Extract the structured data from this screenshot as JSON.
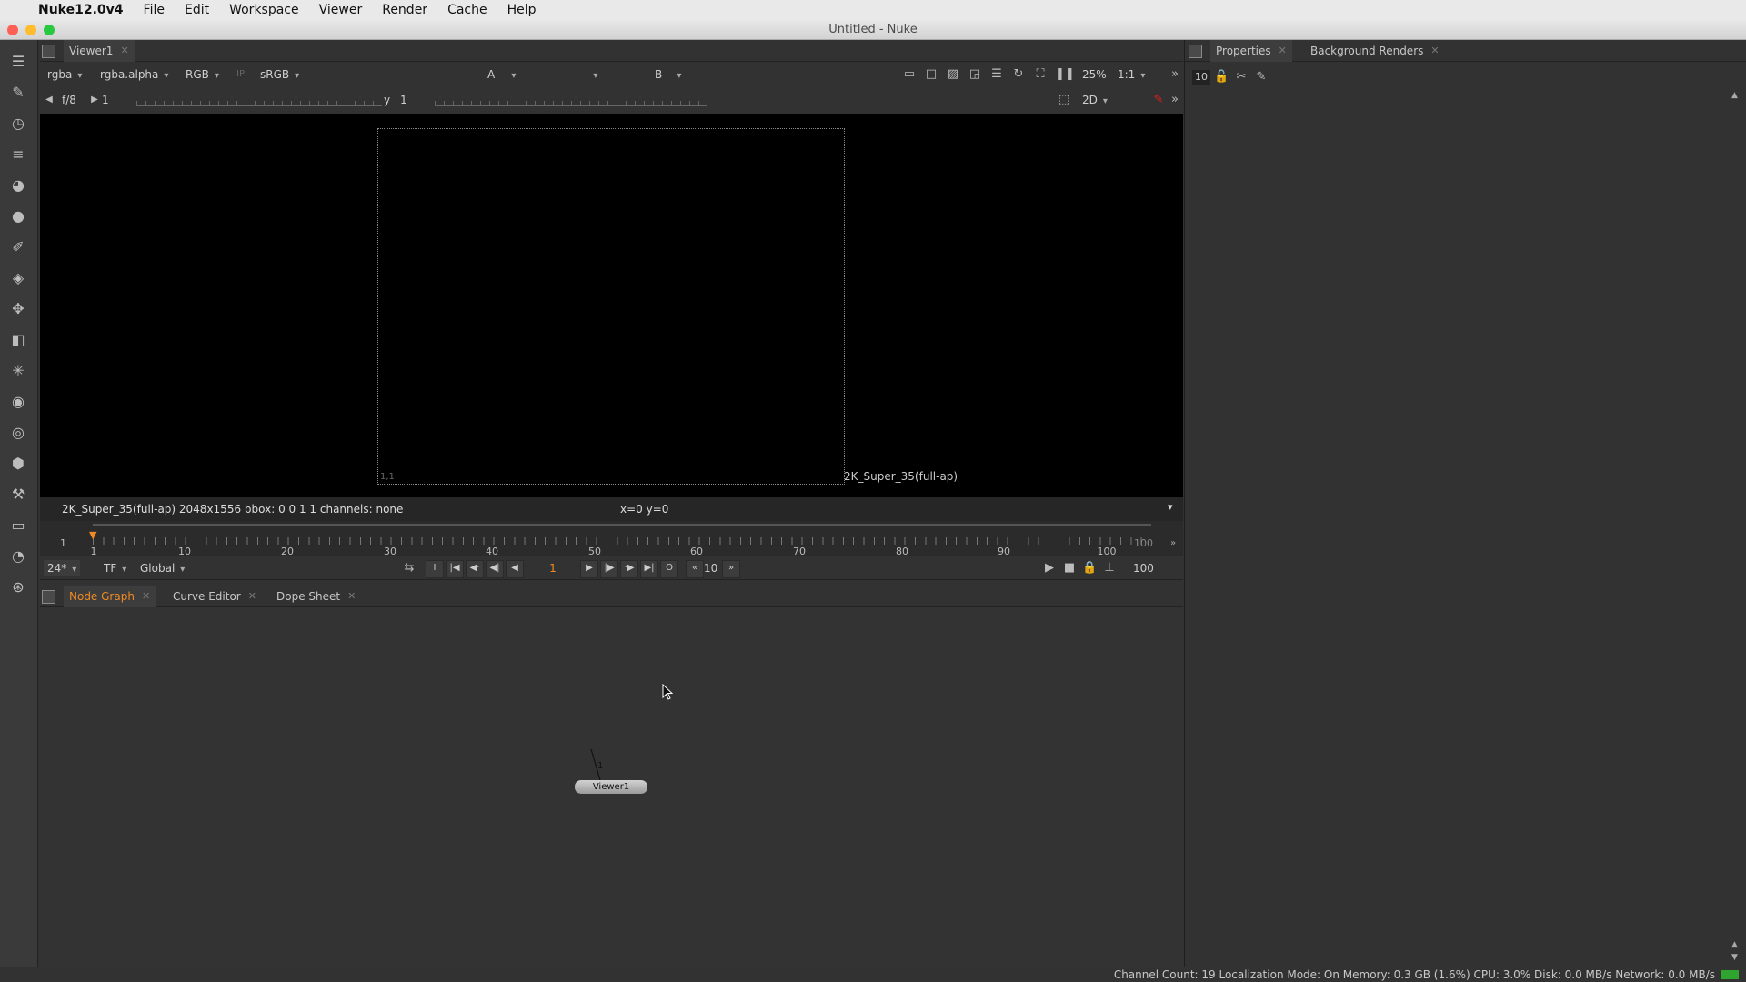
{
  "menubar": {
    "app_name": "Nuke12.0v4",
    "items": [
      "File",
      "Edit",
      "Workspace",
      "Viewer",
      "Render",
      "Cache",
      "Help"
    ]
  },
  "window": {
    "title": "Untitled - Nuke"
  },
  "toolbar": {
    "icons": [
      "viewer-tools-icon",
      "paint-icon",
      "time-icon",
      "channel-icon",
      "color-icon",
      "filter-icon",
      "draw-icon",
      "merge-icon",
      "transform-icon",
      "3d-icon",
      "particles-icon",
      "deep-icon",
      "views-icon",
      "metadata-icon",
      "toolsets-icon",
      "other-icon",
      "furnace-icon",
      "ocula-icon"
    ]
  },
  "viewer": {
    "tab_label": "Viewer1",
    "channels": "rgba",
    "alpha": "rgba.alpha",
    "display": "RGB",
    "ip": "IP",
    "lut": "sRGB",
    "input_a": "A",
    "input_a_value": "-",
    "wipe": "-",
    "input_b": "B",
    "input_b_value": "-",
    "zoom": "25%",
    "ratio": "1:1",
    "fstop": "f/8",
    "gain": "1",
    "gamma_label": "y",
    "gamma": "1",
    "view_mode": "2D",
    "format_label": "2K_Super_35(full-ap)",
    "corner_label": "1,1",
    "info": "2K_Super_35(full-ap) 2048x1556  bbox: 0 0 1 1 channels: none",
    "coords": "x=0 y=0"
  },
  "timeline": {
    "start": "1",
    "end": "100",
    "current": "1",
    "ticks": [
      "1",
      "10",
      "20",
      "30",
      "40",
      "50",
      "60",
      "70",
      "80",
      "90",
      "100"
    ],
    "fps": "24*",
    "tf": "TF",
    "range": "Global",
    "frame": "1",
    "increment": "10",
    "out_frame": "100"
  },
  "bottom_tabs": [
    "Node Graph",
    "Curve Editor",
    "Dope Sheet"
  ],
  "node_graph": {
    "node_label": "Viewer1",
    "node_input": "1"
  },
  "properties": {
    "tabs": [
      "Properties",
      "Background Renders"
    ],
    "max_panels": "10"
  },
  "status": {
    "text": "Channel Count: 19  Localization Mode: On  Memory: 0.3 GB (1.6%)  CPU: 3.0%  Disk: 0.0 MB/s  Network: 0.0 MB/s"
  },
  "colors": {
    "accent": "#f08a24",
    "menubar": "#e9e9e9",
    "panel": "#323232"
  }
}
